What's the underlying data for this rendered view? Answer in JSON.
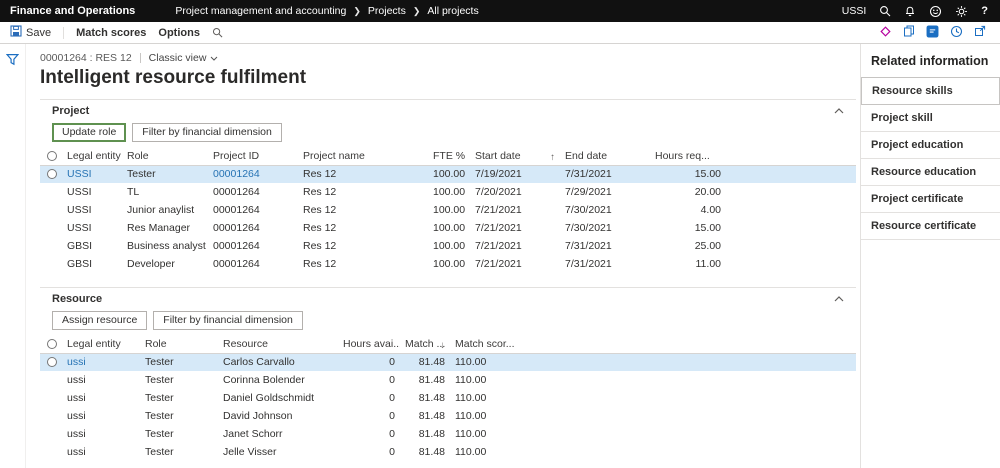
{
  "top_bar": {
    "app_name": "Finance and Operations",
    "breadcrumbs": [
      "Project management and accounting",
      "Projects",
      "All projects"
    ],
    "company": "USSI",
    "help_label": "?"
  },
  "action_bar": {
    "save_label": "Save",
    "match_scores_label": "Match scores",
    "options_label": "Options"
  },
  "page": {
    "record_id": "00001264 : RES 12",
    "view_label": "Classic view",
    "title": "Intelligent resource fulfilment"
  },
  "project": {
    "title": "Project",
    "update_role_label": "Update role",
    "filter_label": "Filter by financial dimension",
    "columns": [
      "Legal entity",
      "Role",
      "Project ID",
      "Project name",
      "FTE %",
      "Start date",
      "End date",
      "Hours req..."
    ],
    "sort_indicator": "↑",
    "rows": [
      [
        "USSI",
        "Tester",
        "00001264",
        "Res 12",
        "100.00",
        "7/19/2021",
        "7/31/2021",
        "15.00"
      ],
      [
        "USSI",
        "TL",
        "00001264",
        "Res 12",
        "100.00",
        "7/20/2021",
        "7/29/2021",
        "20.00"
      ],
      [
        "USSI",
        "Junior anaylist",
        "00001264",
        "Res 12",
        "100.00",
        "7/21/2021",
        "7/30/2021",
        "4.00"
      ],
      [
        "USSI",
        "Res Manager",
        "00001264",
        "Res 12",
        "100.00",
        "7/21/2021",
        "7/30/2021",
        "15.00"
      ],
      [
        "GBSI",
        "Business analyst",
        "00001264",
        "Res 12",
        "100.00",
        "7/21/2021",
        "7/31/2021",
        "25.00"
      ],
      [
        "GBSI",
        "Developer",
        "00001264",
        "Res 12",
        "100.00",
        "7/21/2021",
        "7/31/2021",
        "11.00"
      ]
    ]
  },
  "resource": {
    "title": "Resource",
    "assign_label": "Assign resource",
    "filter_label": "Filter by financial dimension",
    "columns": [
      "Legal entity",
      "Role",
      "Resource",
      "Hours avai...",
      "Match ...",
      "Match scor..."
    ],
    "sort_indicator": "↓",
    "rows": [
      [
        "ussi",
        "Tester",
        "Carlos Carvallo",
        "0",
        "81.48",
        "110.00"
      ],
      [
        "ussi",
        "Tester",
        "Corinna Bolender",
        "0",
        "81.48",
        "110.00"
      ],
      [
        "ussi",
        "Tester",
        "Daniel Goldschmidt",
        "0",
        "81.48",
        "110.00"
      ],
      [
        "ussi",
        "Tester",
        "David Johnson",
        "0",
        "81.48",
        "110.00"
      ],
      [
        "ussi",
        "Tester",
        "Janet Schorr",
        "0",
        "81.48",
        "110.00"
      ],
      [
        "ussi",
        "Tester",
        "Jelle Visser",
        "0",
        "81.48",
        "110.00"
      ]
    ]
  },
  "related": {
    "title": "Related information",
    "items": [
      "Resource skills",
      "Project skill",
      "Project education",
      "Resource education",
      "Project certificate",
      "Resource certificate"
    ]
  },
  "colors": {
    "accent": "#1b6ec2",
    "link": "#2673b4",
    "selected_row": "#d6e9f8",
    "topbar": "#111111"
  }
}
